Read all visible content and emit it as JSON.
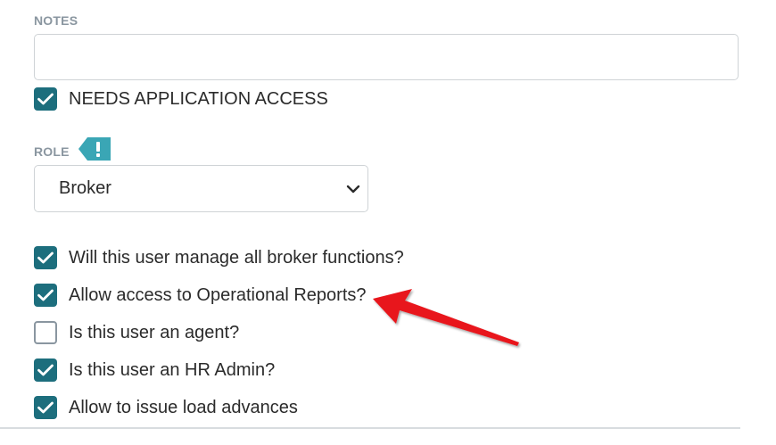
{
  "notes": {
    "label": "NOTES",
    "value": ""
  },
  "app_access": {
    "label": "NEEDS APPLICATION ACCESS",
    "checked": true
  },
  "role": {
    "label": "ROLE",
    "badge_icon": "exclamation-tag-icon",
    "selected": "Broker"
  },
  "options": [
    {
      "label": "Will this user manage all broker functions?",
      "checked": true
    },
    {
      "label": "Allow access to Operational Reports?",
      "checked": true
    },
    {
      "label": "Is this user an agent?",
      "checked": false
    },
    {
      "label": "Is this user an HR Admin?",
      "checked": true
    },
    {
      "label": "Allow to issue load advances",
      "checked": true
    }
  ],
  "colors": {
    "checkbox_checked": "#1d6e7d",
    "label_muted": "#8a96a0",
    "badge": "#3aa6b5",
    "annotation_arrow": "#e8141b"
  }
}
